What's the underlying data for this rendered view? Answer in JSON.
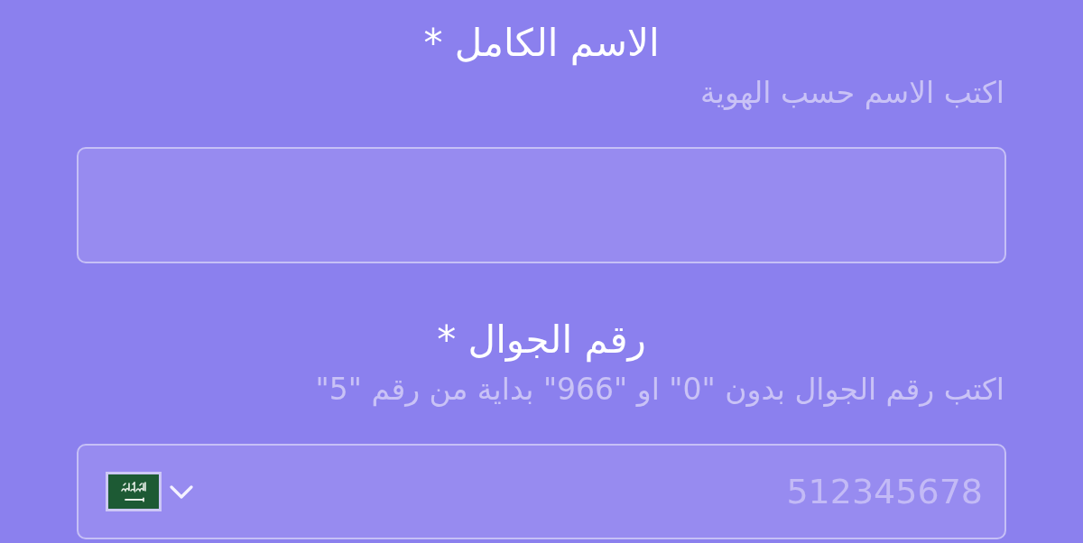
{
  "fields": [
    {
      "kind": "text",
      "label": "الاسم الكامل *",
      "hint": "اكتب الاسم حسب الهوية"
    },
    {
      "kind": "phone",
      "label": "رقم الجوال *",
      "hint": "اكتب رقم الجوال بدون \"0\" او \"966\" بداية من رقم \"5\"",
      "placeholder": "512345678"
    }
  ]
}
